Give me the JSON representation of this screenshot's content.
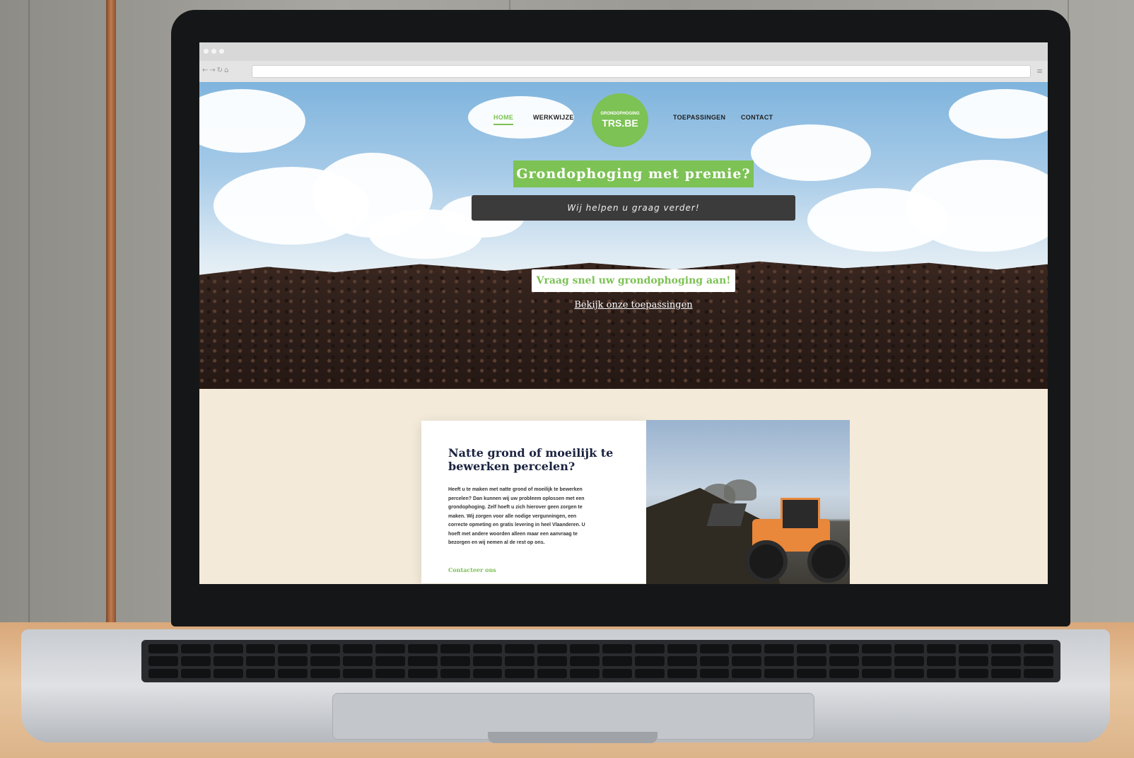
{
  "site": {
    "nav": {
      "home": "HOME",
      "werkwijze": "WERKWIJZE",
      "toepassingen": "TOEPASSINGEN",
      "contact": "CONTACT"
    },
    "logo": {
      "top": "GRONDOPHOGING",
      "main": "TRS.BE"
    },
    "hero": {
      "headline": "Grondophoging met premie?",
      "subline": "Wij helpen u graag verder!",
      "cta": "Vraag snel uw grondophoging aan!",
      "link": "Bekijk onze toepassingen"
    },
    "card": {
      "title": "Natte grond of moeilijk te bewerken percelen?",
      "body": "Heeft u te maken met natte grond of moeilijk te bewerken percelen? Dan kunnen wij uw probleem oplossen met een grondophoging. Zelf hoeft u zich hierover geen zorgen te maken. Wij zorgen voor alle nodige vergunningen, een correcte opmeting en gratis levering in heel Vlaanderen. U hoeft met andere woorden alleen maar een aanvraag te bezorgen en wij nemen al de rest op ons.",
      "link": "Contacteer ons"
    }
  },
  "colors": {
    "accent_green": "#7cc254",
    "dark_bar": "#3c3b3b",
    "navy_title": "#1b2340",
    "cream_bg": "#f3ead9"
  },
  "icons": {
    "window_dots": "traffic-lights-icon",
    "back": "back-arrow-icon",
    "forward": "forward-arrow-icon",
    "reload": "reload-icon",
    "home": "home-icon",
    "menu": "hamburger-menu-icon"
  }
}
